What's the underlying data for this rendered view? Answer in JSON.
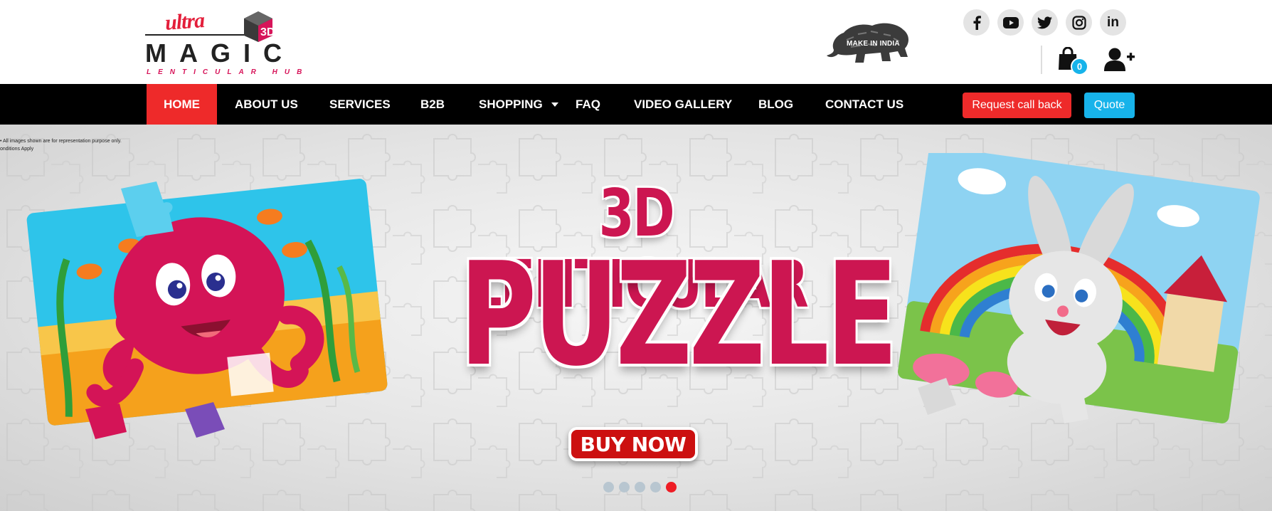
{
  "brand": {
    "logo_ultra": "ultra",
    "logo_3d": "3D",
    "logo_magic": "MAGIC",
    "logo_sub": "LENTICULAR HUB",
    "make_in_india": "MAKE IN INDIA"
  },
  "socials": [
    "facebook-icon",
    "youtube-icon",
    "twitter-icon",
    "instagram-icon",
    "linkedin-icon"
  ],
  "linkedin_text": "in",
  "cart": {
    "count": "0"
  },
  "nav": {
    "items": [
      {
        "label": "HOME",
        "active": true
      },
      {
        "label": "ABOUT US"
      },
      {
        "label": "SERVICES"
      },
      {
        "label": "B2B"
      },
      {
        "label": "SHOPPING",
        "has_dropdown": true
      },
      {
        "label": "FAQ"
      },
      {
        "label": "VIDEO GALLERY"
      },
      {
        "label": "BLOG"
      },
      {
        "label": "CONTACT US"
      }
    ],
    "callback_label": "Request call back",
    "quote_label": "Quote"
  },
  "hero": {
    "disclaimer_line1": "• All images shown are for representation purpose only.",
    "disclaimer_line2": "onditions Apply",
    "title_line1": "3D LENTICULAR",
    "title_line2": "PUZZLE",
    "cta_label": "BUY NOW",
    "slide_count": 5,
    "active_slide": 5
  },
  "colors": {
    "accent_red": "#ee2a2a",
    "accent_blue": "#17b3ea",
    "title_pink": "#cc1651",
    "nav_bg": "#000000"
  }
}
